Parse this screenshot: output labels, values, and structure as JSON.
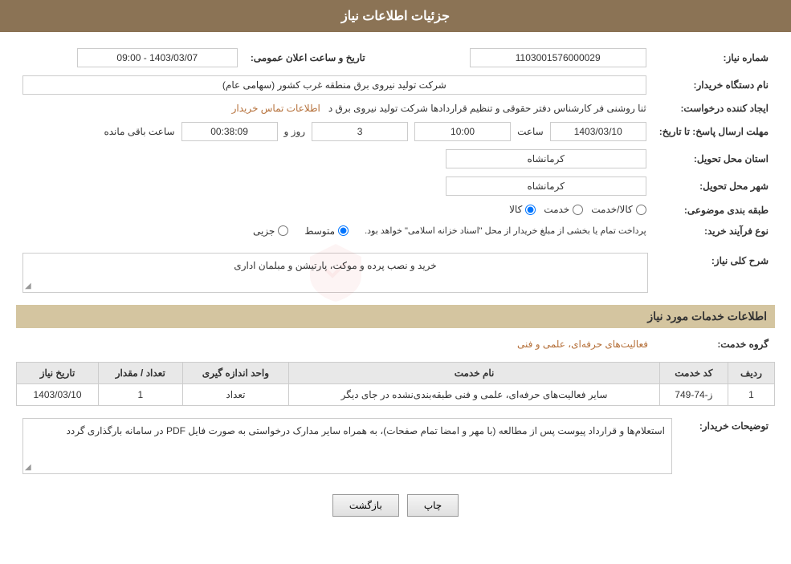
{
  "header": {
    "title": "جزئیات اطلاعات نیاز"
  },
  "fields": {
    "need_number_label": "شماره نیاز:",
    "need_number_value": "1103001576000029",
    "buyer_org_label": "نام دستگاه خریدار:",
    "buyer_org_value": "شرکت تولید نیروی برق منطقه غرب کشور (سهامی عام)",
    "creator_label": "ایجاد کننده درخواست:",
    "creator_value": "ثنا روشنی فر کارشناس دفتر حقوقی و تنظیم قراردادها شرکت تولید نیروی برق د",
    "creator_link": "اطلاعات تماس خریدار",
    "announce_date_label": "تاریخ و ساعت اعلان عمومی:",
    "announce_date_value": "1403/03/07 - 09:00",
    "reply_deadline_label": "مهلت ارسال پاسخ: تا تاریخ:",
    "reply_date_value": "1403/03/10",
    "reply_time_label": "ساعت",
    "reply_time_value": "10:00",
    "reply_day_label": "روز و",
    "reply_day_value": "3",
    "remaining_label": "ساعت باقی مانده",
    "remaining_value": "00:38:09",
    "province_label": "استان محل تحویل:",
    "province_value": "کرمانشاه",
    "city_label": "شهر محل تحویل:",
    "city_value": "کرمانشاه",
    "category_label": "طبقه بندی موضوعی:",
    "category_options": [
      "کالا",
      "خدمت",
      "کالا/خدمت"
    ],
    "category_selected": "کالا",
    "process_type_label": "نوع فرآیند خرید:",
    "process_options": [
      "جزیی",
      "متوسط"
    ],
    "process_selected": "متوسط",
    "process_note": "پرداخت تمام یا بخشی از مبلغ خریدار از محل \"اسناد خزانه اسلامی\" خواهد بود.",
    "general_desc_label": "شرح کلی نیاز:",
    "general_desc_value": "خرید و نصب پرده و موکت، پارتیشن و مبلمان اداری",
    "services_section_label": "اطلاعات خدمات مورد نیاز",
    "service_group_label": "گروه خدمت:",
    "service_group_value": "فعالیت‌های حرفه‌ای، علمی و فنی",
    "table": {
      "headers": [
        "ردیف",
        "کد خدمت",
        "نام خدمت",
        "واحد اندازه گیری",
        "تعداد / مقدار",
        "تاریخ نیاز"
      ],
      "rows": [
        {
          "row": "1",
          "code": "ز-74-749",
          "name": "سایر فعالیت‌های حرفه‌ای، علمی و فنی طبقه‌بندی‌نشده در جای دیگر",
          "unit": "تعداد",
          "qty": "1",
          "date": "1403/03/10"
        }
      ]
    },
    "buyer_notes_label": "توضیحات خریدار:",
    "buyer_notes_value": "استعلام‌ها و قرارداد پیوست پس از مطالعه (با مهر و امضا تمام صفحات)، به همراه سایر مدارک درخواستی به صورت فایل PDF در سامانه بارگذاری گردد",
    "btn_back": "بازگشت",
    "btn_print": "چاپ"
  }
}
